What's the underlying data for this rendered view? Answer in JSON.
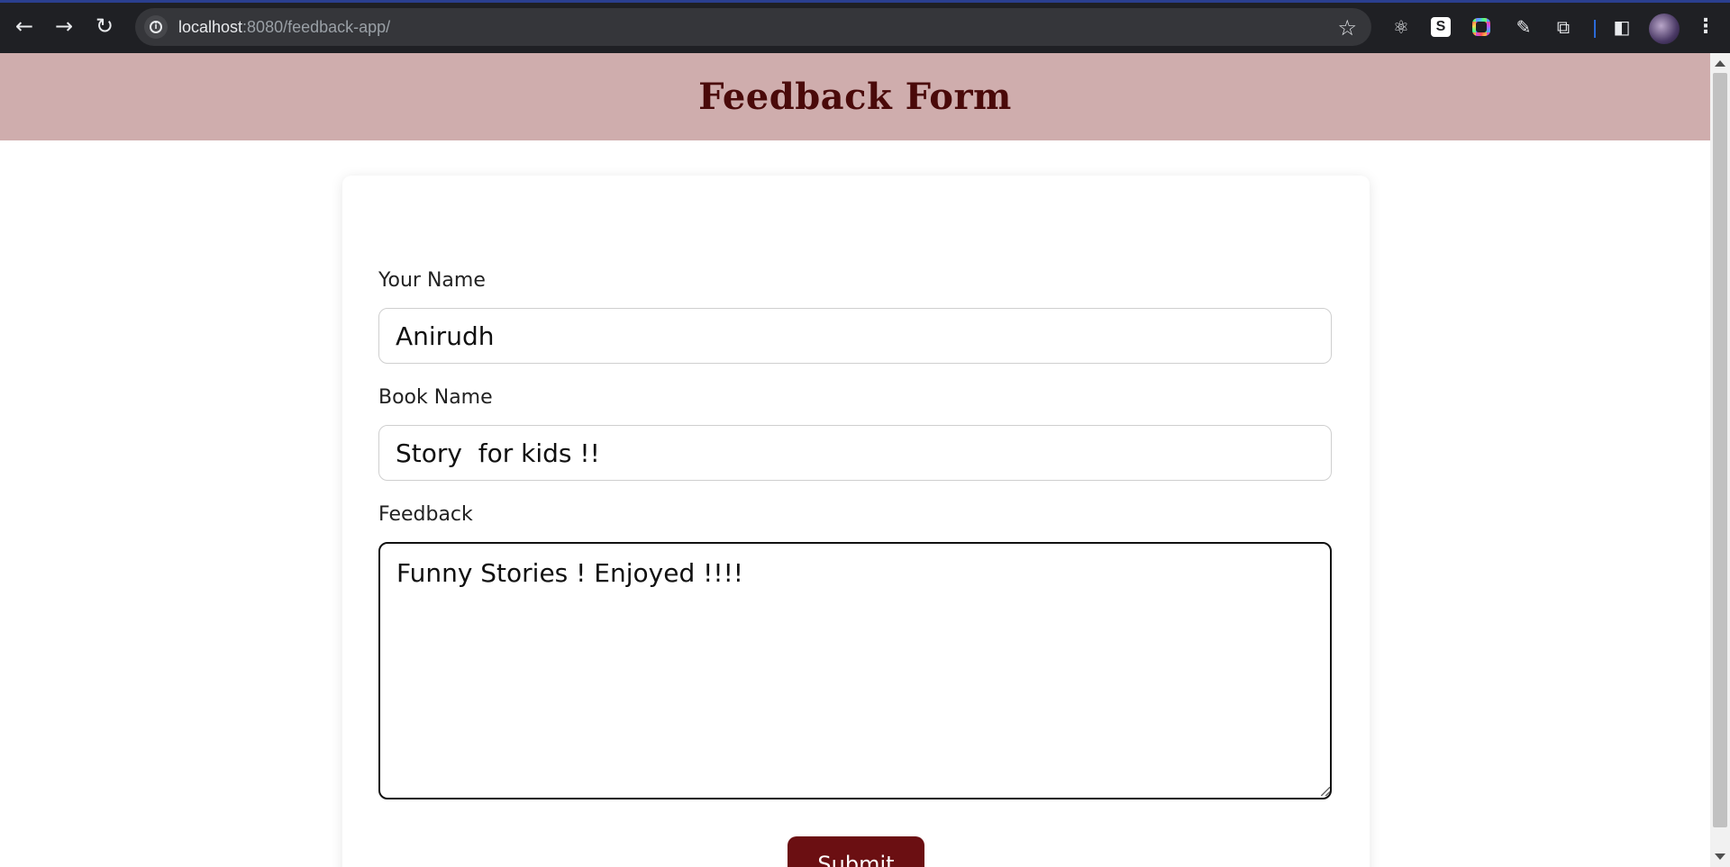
{
  "browser": {
    "url_host": "localhost",
    "url_path": ":8080/feedback-app/",
    "icons": {
      "back": "back-arrow-icon",
      "forward": "forward-arrow-icon",
      "reload": "reload-icon",
      "info": "site-info-icon",
      "bookmark": "star-icon",
      "extensions": [
        "react-devtools-icon",
        "s-extension-icon",
        "color-ring-extension-icon",
        "eyedropper-icon",
        "puzzle-extensions-icon",
        "side-panel-icon"
      ],
      "profile": "avatar",
      "menu": "kebab-menu-icon"
    }
  },
  "page": {
    "title": "Feedback Form",
    "colors": {
      "header_bg": "#cfadad",
      "title": "#4a0a0a",
      "button_bg": "#6b0f12"
    }
  },
  "form": {
    "name_label": "Your Name",
    "name_value": "Anirudh",
    "book_label": "Book Name",
    "book_value": "Story  for kids !!",
    "feedback_label": "Feedback",
    "feedback_value": "Funny Stories ! Enjoyed !!!!",
    "submit_label": "Submit"
  }
}
